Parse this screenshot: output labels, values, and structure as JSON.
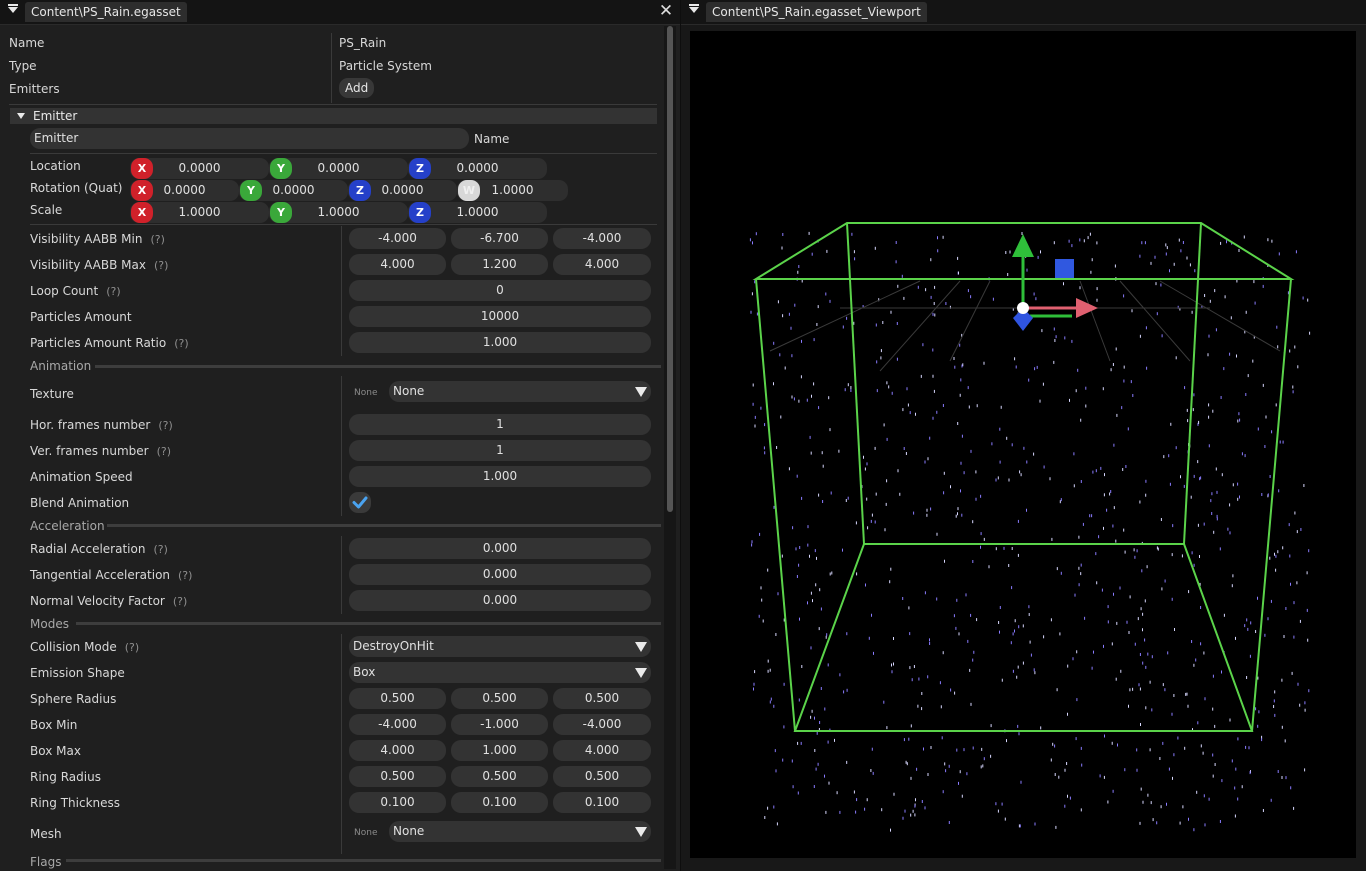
{
  "left_panel": {
    "tab_title": "Content\\PS_Rain.egasset",
    "props": {
      "name_label": "Name",
      "name_value": "PS_Rain",
      "type_label": "Type",
      "type_value": "Particle System",
      "emitters_label": "Emitters",
      "add_button": "Add"
    },
    "emitter": {
      "header": "Emitter",
      "name_value": "Emitter",
      "name_label": "Name",
      "transform": {
        "location_label": "Location",
        "rotation_label": "Rotation (Quat)",
        "scale_label": "Scale",
        "location": [
          "0.0000",
          "0.0000",
          "0.0000"
        ],
        "rotation": [
          "0.0000",
          "0.0000",
          "0.0000",
          "1.0000"
        ],
        "scale": [
          "1.0000",
          "1.0000",
          "1.0000"
        ],
        "axis_x": "X",
        "axis_y": "Y",
        "axis_z": "Z",
        "axis_w": "W"
      },
      "help": "(?)",
      "vis_min": {
        "label": "Visibility AABB Min",
        "values": [
          "-4.000",
          "-6.700",
          "-4.000"
        ]
      },
      "vis_max": {
        "label": "Visibility AABB Max",
        "values": [
          "4.000",
          "1.200",
          "4.000"
        ]
      },
      "loop_count": {
        "label": "Loop Count",
        "value": "0"
      },
      "particles_amount": {
        "label": "Particles Amount",
        "value": "10000"
      },
      "particles_ratio": {
        "label": "Particles Amount Ratio",
        "value": "1.000"
      },
      "animation_section": "Animation",
      "texture": {
        "label": "Texture",
        "tag": "None",
        "value": "None"
      },
      "hor_frames": {
        "label": "Hor. frames number",
        "value": "1"
      },
      "ver_frames": {
        "label": "Ver. frames number",
        "value": "1"
      },
      "anim_speed": {
        "label": "Animation Speed",
        "value": "1.000"
      },
      "blend_anim": {
        "label": "Blend Animation",
        "checked": true
      },
      "acceleration_section": "Acceleration",
      "radial_acc": {
        "label": "Radial Acceleration",
        "value": "0.000"
      },
      "tangential_acc": {
        "label": "Tangential Acceleration",
        "value": "0.000"
      },
      "normal_vel": {
        "label": "Normal Velocity Factor",
        "value": "0.000"
      },
      "modes_section": "Modes",
      "collision_mode": {
        "label": "Collision Mode",
        "value": "DestroyOnHit"
      },
      "emission_shape": {
        "label": "Emission Shape",
        "value": "Box"
      },
      "sphere_radius": {
        "label": "Sphere Radius",
        "values": [
          "0.500",
          "0.500",
          "0.500"
        ]
      },
      "box_min": {
        "label": "Box Min",
        "values": [
          "-4.000",
          "-1.000",
          "-4.000"
        ]
      },
      "box_max": {
        "label": "Box Max",
        "values": [
          "4.000",
          "1.000",
          "4.000"
        ]
      },
      "ring_radius": {
        "label": "Ring Radius",
        "values": [
          "0.500",
          "0.500",
          "0.500"
        ]
      },
      "ring_thickness": {
        "label": "Ring Thickness",
        "values": [
          "0.100",
          "0.100",
          "0.100"
        ]
      },
      "mesh": {
        "label": "Mesh",
        "tag": "None",
        "value": "None"
      },
      "flags_section": "Flags"
    }
  },
  "right_panel": {
    "tab_title": "Content\\PS_Rain.egasset_Viewport"
  },
  "colors": {
    "axis_x": "#d0212a",
    "axis_y": "#3aa83a",
    "axis_z": "#2540c9",
    "bounds_box": "#5bd34a",
    "checkbox_accent": "#4aa3f0"
  }
}
